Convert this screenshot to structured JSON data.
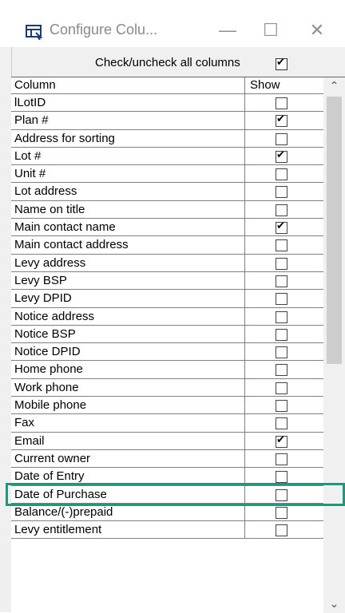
{
  "window": {
    "title": "Configure Colu...",
    "icons": {
      "app": "table-config-icon",
      "minimize": "minimize-icon",
      "maximize": "maximize-icon",
      "close": "close-icon"
    },
    "minimize_glyph": "—",
    "maximize_glyph": "☐",
    "close_glyph": "✕"
  },
  "toggle_all": {
    "label": "Check/uncheck all columns",
    "checked": true
  },
  "grid": {
    "headers": {
      "column": "Column",
      "show": "Show"
    },
    "rows": [
      {
        "name": "lLotID",
        "show": false
      },
      {
        "name": "Plan #",
        "show": true
      },
      {
        "name": "Address for sorting",
        "show": false
      },
      {
        "name": "Lot #",
        "show": true
      },
      {
        "name": "Unit #",
        "show": false
      },
      {
        "name": "Lot address",
        "show": false
      },
      {
        "name": "Name on title",
        "show": false
      },
      {
        "name": "Main contact name",
        "show": true
      },
      {
        "name": "Main contact address",
        "show": false
      },
      {
        "name": "Levy address",
        "show": false
      },
      {
        "name": "Levy BSP",
        "show": false
      },
      {
        "name": "Levy DPID",
        "show": false
      },
      {
        "name": "Notice address",
        "show": false
      },
      {
        "name": "Notice BSP",
        "show": false
      },
      {
        "name": "Notice DPID",
        "show": false
      },
      {
        "name": "Home phone",
        "show": false
      },
      {
        "name": "Work phone",
        "show": false
      },
      {
        "name": "Mobile phone",
        "show": false
      },
      {
        "name": "Fax",
        "show": false
      },
      {
        "name": "Email",
        "show": true
      },
      {
        "name": "Current owner",
        "show": false
      },
      {
        "name": "Date of Entry",
        "show": false
      },
      {
        "name": "Date of Purchase",
        "show": false
      },
      {
        "name": "Balance/(-)prepaid",
        "show": false
      },
      {
        "name": "Levy entitlement",
        "show": false
      }
    ]
  },
  "scrollbar": {
    "up_glyph": "⌃",
    "down_glyph": "⌄"
  },
  "highlight_color": "#1a9a7a"
}
